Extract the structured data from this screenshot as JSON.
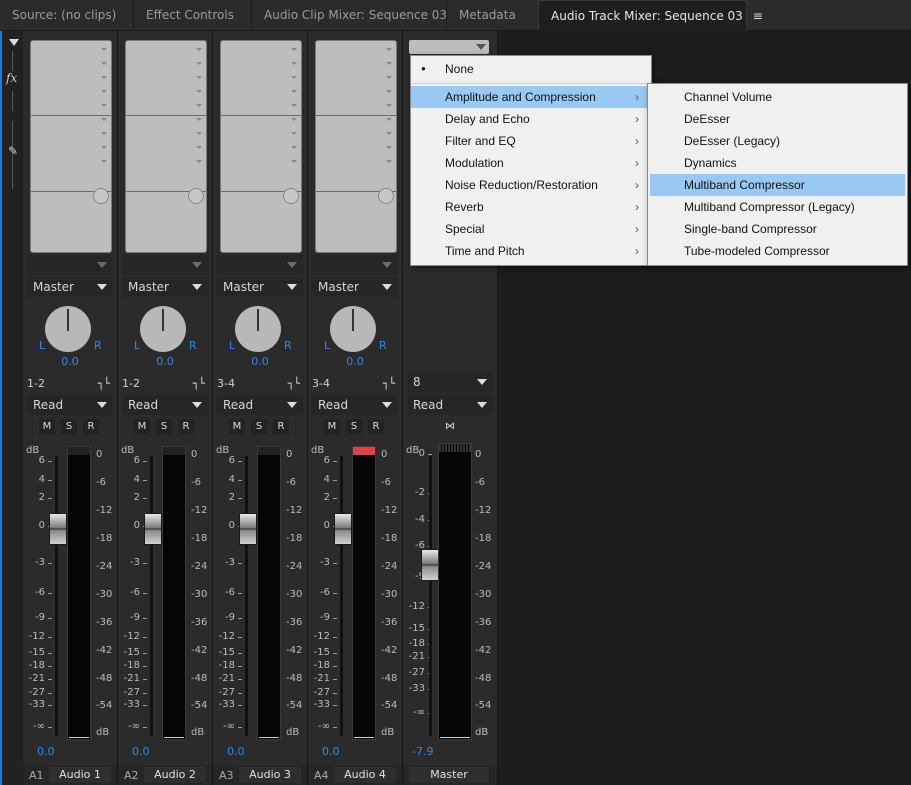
{
  "tabs": [
    {
      "label": "Source: (no clips)"
    },
    {
      "label": "Effect Controls"
    },
    {
      "label": "Audio Clip Mixer: Sequence 03"
    },
    {
      "label": "Metadata"
    },
    {
      "label": "Audio Track Mixer: Sequence 03",
      "menu_glyph": "≡"
    }
  ],
  "rail": {
    "fx": "fx",
    "tool": "✎"
  },
  "tracks": [
    {
      "output": "Master",
      "pan_left": "L",
      "pan_right": "R",
      "pan": "0.0",
      "route": "1-2",
      "route_icon": "┐└",
      "auto": "Read",
      "m": "M",
      "s": "S",
      "r": "R",
      "db": "dB",
      "volume": "0.0",
      "id": "A1",
      "name": "Audio 1",
      "clip": false
    },
    {
      "output": "Master",
      "pan_left": "L",
      "pan_right": "R",
      "pan": "0.0",
      "route": "1-2",
      "route_icon": "┐└",
      "auto": "Read",
      "m": "M",
      "s": "S",
      "r": "R",
      "db": "dB",
      "volume": "0.0",
      "id": "A2",
      "name": "Audio 2",
      "clip": false
    },
    {
      "output": "Master",
      "pan_left": "L",
      "pan_right": "R",
      "pan": "0.0",
      "route": "3-4",
      "route_icon": "┐└",
      "auto": "Read",
      "m": "M",
      "s": "S",
      "r": "R",
      "db": "dB",
      "volume": "0.0",
      "id": "A3",
      "name": "Audio 3",
      "clip": false
    },
    {
      "output": "Master",
      "pan_left": "L",
      "pan_right": "R",
      "pan": "0.0",
      "route": "3-4",
      "route_icon": "┐└",
      "auto": "Read",
      "m": "M",
      "s": "S",
      "r": "R",
      "db": "dB",
      "volume": "0.0",
      "id": "A4",
      "name": "Audio 4",
      "clip": true
    }
  ],
  "master": {
    "channels": "8",
    "auto": "Read",
    "link_icon": "⋈",
    "db": "dB",
    "volume": "-7.9",
    "name": "Master"
  },
  "fader_scale": [
    "6",
    "4",
    "2",
    "0",
    "-3",
    "-6",
    "-9",
    "-12",
    "-15",
    "-18",
    "-21",
    "-27",
    "-33",
    "-∞"
  ],
  "master_scale": [
    "0",
    "-2",
    "-4",
    "-6",
    "-9",
    "-12",
    "-15",
    "-18",
    "-21",
    "-27",
    "-33",
    "-∞"
  ],
  "meter_scale": [
    "0",
    "-6",
    "-12",
    "-18",
    "-24",
    "-30",
    "-36",
    "-42",
    "-48",
    "-54",
    "dB"
  ],
  "menu": {
    "none_label": "None",
    "none_bullet": "●",
    "chevron": "›",
    "categories": [
      "Amplitude and Compression",
      "Delay and Echo",
      "Filter and EQ",
      "Modulation",
      "Noise Reduction/Restoration",
      "Reverb",
      "Special",
      "Time and Pitch"
    ],
    "highlighted_category": "Amplitude and Compression",
    "submenu": [
      "Channel Volume",
      "DeEsser",
      "DeEsser (Legacy)",
      "Dynamics",
      "Multiband Compressor",
      "Multiband Compressor (Legacy)",
      "Single-band Compressor",
      "Tube-modeled Compressor"
    ],
    "highlighted_item": "Multiband Compressor"
  },
  "colors": {
    "accent": "#2d8ceb",
    "highlight": "#99c9f2",
    "clip": "#e0404a"
  }
}
